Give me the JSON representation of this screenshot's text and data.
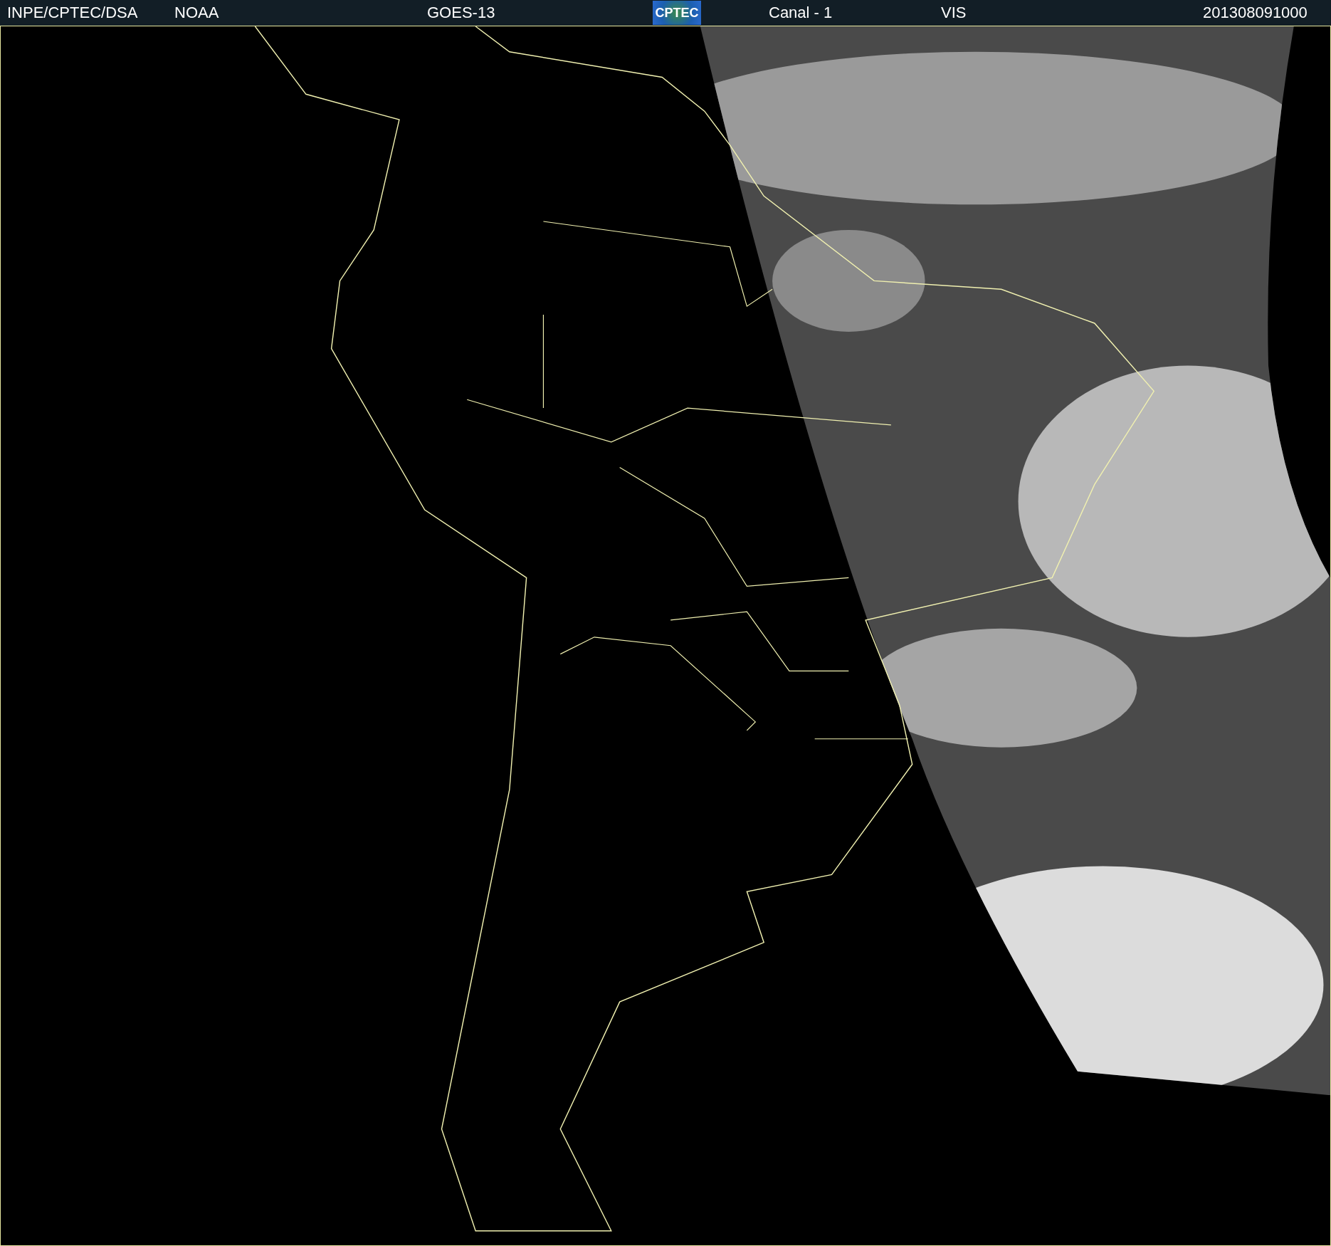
{
  "header": {
    "institution": "INPE/CPTEC/DSA",
    "agency": "NOAA",
    "satellite": "GOES-13",
    "logo": "CPTEC",
    "channel": "Canal - 1",
    "band": "VIS",
    "timestamp": "201308091000"
  }
}
